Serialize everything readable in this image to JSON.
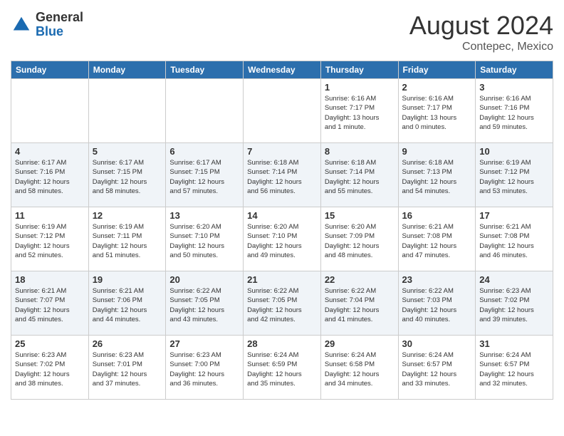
{
  "header": {
    "logo": {
      "line1": "General",
      "line2": "Blue"
    },
    "title": "August 2024",
    "subtitle": "Contepec, Mexico"
  },
  "calendar": {
    "days_of_week": [
      "Sunday",
      "Monday",
      "Tuesday",
      "Wednesday",
      "Thursday",
      "Friday",
      "Saturday"
    ],
    "weeks": [
      {
        "days": [
          {
            "number": "",
            "info": ""
          },
          {
            "number": "",
            "info": ""
          },
          {
            "number": "",
            "info": ""
          },
          {
            "number": "",
            "info": ""
          },
          {
            "number": "1",
            "info": "Sunrise: 6:16 AM\nSunset: 7:17 PM\nDaylight: 13 hours\nand 1 minute."
          },
          {
            "number": "2",
            "info": "Sunrise: 6:16 AM\nSunset: 7:17 PM\nDaylight: 13 hours\nand 0 minutes."
          },
          {
            "number": "3",
            "info": "Sunrise: 6:16 AM\nSunset: 7:16 PM\nDaylight: 12 hours\nand 59 minutes."
          }
        ]
      },
      {
        "days": [
          {
            "number": "4",
            "info": "Sunrise: 6:17 AM\nSunset: 7:16 PM\nDaylight: 12 hours\nand 58 minutes."
          },
          {
            "number": "5",
            "info": "Sunrise: 6:17 AM\nSunset: 7:15 PM\nDaylight: 12 hours\nand 58 minutes."
          },
          {
            "number": "6",
            "info": "Sunrise: 6:17 AM\nSunset: 7:15 PM\nDaylight: 12 hours\nand 57 minutes."
          },
          {
            "number": "7",
            "info": "Sunrise: 6:18 AM\nSunset: 7:14 PM\nDaylight: 12 hours\nand 56 minutes."
          },
          {
            "number": "8",
            "info": "Sunrise: 6:18 AM\nSunset: 7:14 PM\nDaylight: 12 hours\nand 55 minutes."
          },
          {
            "number": "9",
            "info": "Sunrise: 6:18 AM\nSunset: 7:13 PM\nDaylight: 12 hours\nand 54 minutes."
          },
          {
            "number": "10",
            "info": "Sunrise: 6:19 AM\nSunset: 7:12 PM\nDaylight: 12 hours\nand 53 minutes."
          }
        ]
      },
      {
        "days": [
          {
            "number": "11",
            "info": "Sunrise: 6:19 AM\nSunset: 7:12 PM\nDaylight: 12 hours\nand 52 minutes."
          },
          {
            "number": "12",
            "info": "Sunrise: 6:19 AM\nSunset: 7:11 PM\nDaylight: 12 hours\nand 51 minutes."
          },
          {
            "number": "13",
            "info": "Sunrise: 6:20 AM\nSunset: 7:10 PM\nDaylight: 12 hours\nand 50 minutes."
          },
          {
            "number": "14",
            "info": "Sunrise: 6:20 AM\nSunset: 7:10 PM\nDaylight: 12 hours\nand 49 minutes."
          },
          {
            "number": "15",
            "info": "Sunrise: 6:20 AM\nSunset: 7:09 PM\nDaylight: 12 hours\nand 48 minutes."
          },
          {
            "number": "16",
            "info": "Sunrise: 6:21 AM\nSunset: 7:08 PM\nDaylight: 12 hours\nand 47 minutes."
          },
          {
            "number": "17",
            "info": "Sunrise: 6:21 AM\nSunset: 7:08 PM\nDaylight: 12 hours\nand 46 minutes."
          }
        ]
      },
      {
        "days": [
          {
            "number": "18",
            "info": "Sunrise: 6:21 AM\nSunset: 7:07 PM\nDaylight: 12 hours\nand 45 minutes."
          },
          {
            "number": "19",
            "info": "Sunrise: 6:21 AM\nSunset: 7:06 PM\nDaylight: 12 hours\nand 44 minutes."
          },
          {
            "number": "20",
            "info": "Sunrise: 6:22 AM\nSunset: 7:05 PM\nDaylight: 12 hours\nand 43 minutes."
          },
          {
            "number": "21",
            "info": "Sunrise: 6:22 AM\nSunset: 7:05 PM\nDaylight: 12 hours\nand 42 minutes."
          },
          {
            "number": "22",
            "info": "Sunrise: 6:22 AM\nSunset: 7:04 PM\nDaylight: 12 hours\nand 41 minutes."
          },
          {
            "number": "23",
            "info": "Sunrise: 6:22 AM\nSunset: 7:03 PM\nDaylight: 12 hours\nand 40 minutes."
          },
          {
            "number": "24",
            "info": "Sunrise: 6:23 AM\nSunset: 7:02 PM\nDaylight: 12 hours\nand 39 minutes."
          }
        ]
      },
      {
        "days": [
          {
            "number": "25",
            "info": "Sunrise: 6:23 AM\nSunset: 7:02 PM\nDaylight: 12 hours\nand 38 minutes."
          },
          {
            "number": "26",
            "info": "Sunrise: 6:23 AM\nSunset: 7:01 PM\nDaylight: 12 hours\nand 37 minutes."
          },
          {
            "number": "27",
            "info": "Sunrise: 6:23 AM\nSunset: 7:00 PM\nDaylight: 12 hours\nand 36 minutes."
          },
          {
            "number": "28",
            "info": "Sunrise: 6:24 AM\nSunset: 6:59 PM\nDaylight: 12 hours\nand 35 minutes."
          },
          {
            "number": "29",
            "info": "Sunrise: 6:24 AM\nSunset: 6:58 PM\nDaylight: 12 hours\nand 34 minutes."
          },
          {
            "number": "30",
            "info": "Sunrise: 6:24 AM\nSunset: 6:57 PM\nDaylight: 12 hours\nand 33 minutes."
          },
          {
            "number": "31",
            "info": "Sunrise: 6:24 AM\nSunset: 6:57 PM\nDaylight: 12 hours\nand 32 minutes."
          }
        ]
      }
    ]
  }
}
